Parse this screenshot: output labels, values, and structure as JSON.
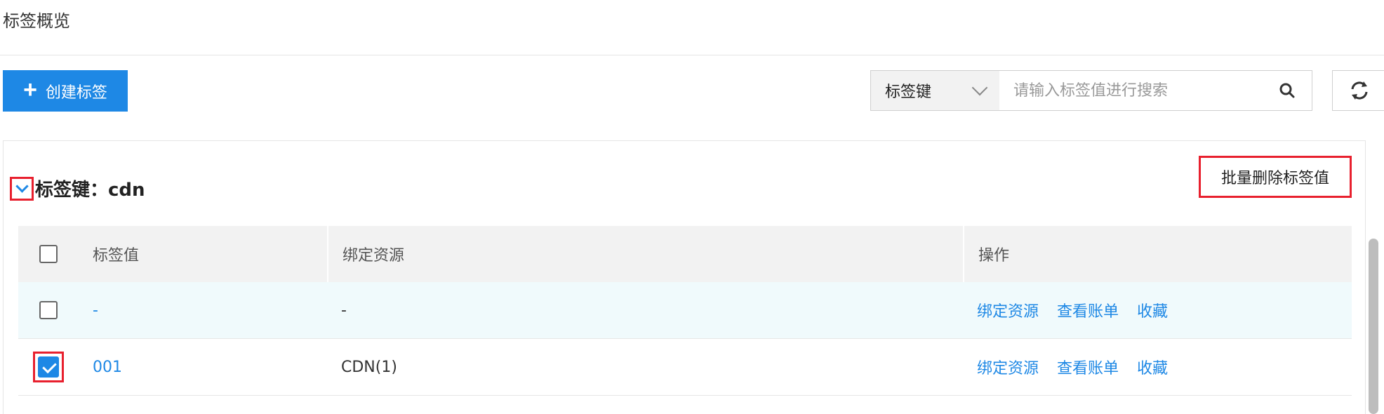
{
  "page": {
    "title": "标签概览"
  },
  "toolbar": {
    "create_label": "创建标签",
    "search": {
      "select_value": "标签键",
      "placeholder": "请输入标签值进行搜索"
    }
  },
  "group": {
    "title": "标签键：cdn",
    "batch_delete_label": "批量删除标签值"
  },
  "table": {
    "headers": {
      "value": "标签值",
      "resource": "绑定资源",
      "actions": "操作"
    },
    "rows": [
      {
        "value": "-",
        "resource": "-",
        "checked": false,
        "actions": [
          "绑定资源",
          "查看账单",
          "收藏"
        ]
      },
      {
        "value": "001",
        "resource": "CDN(1)",
        "checked": true,
        "actions": [
          "绑定资源",
          "查看账单",
          "收藏"
        ]
      }
    ]
  },
  "colors": {
    "accent": "#1e88e5",
    "highlight": "#e8202e"
  },
  "icons": {
    "create": "plus-icon",
    "search": "search-icon",
    "refresh": "refresh-icon",
    "toggle": "chevron-down-icon"
  }
}
